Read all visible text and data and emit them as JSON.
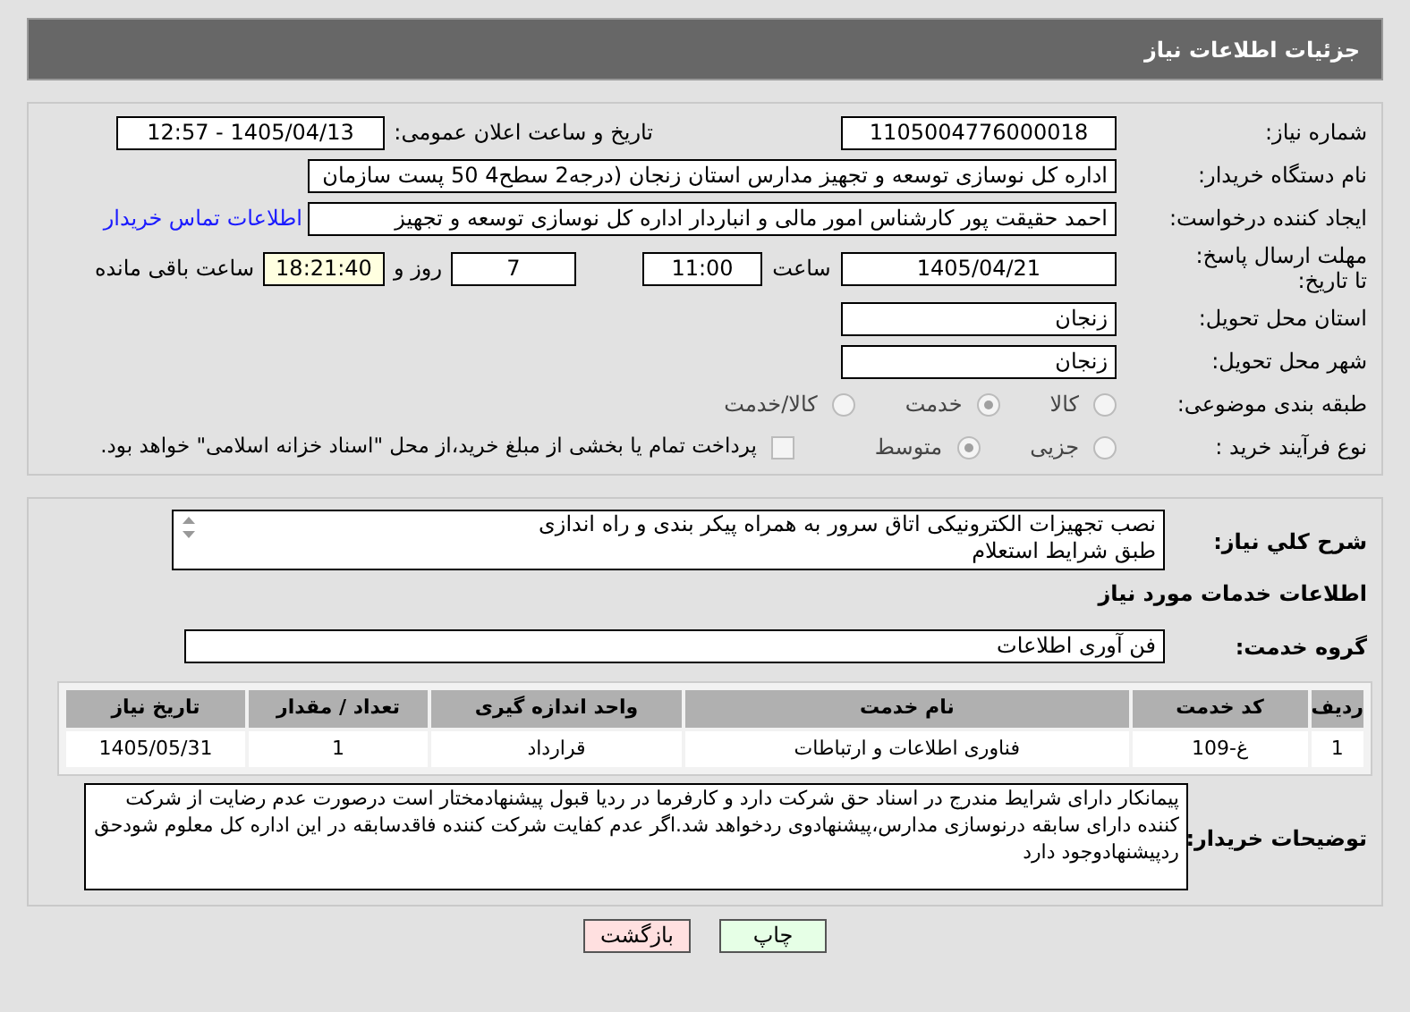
{
  "header": {
    "title": "جزئیات اطلاعات نیاز"
  },
  "need_number": {
    "label": "شماره نیاز:",
    "value": "1105004776000018"
  },
  "announce": {
    "label": "تاریخ و ساعت اعلان عمومی:",
    "value": "1405/04/13 - 12:57"
  },
  "buyer": {
    "label": "نام دستگاه خریدار:",
    "value": "اداره کل نوسازی   توسعه و تجهیز مدارس استان زنجان (درجه2  سطح4  50 پست سازمان"
  },
  "creator": {
    "label": "ایجاد کننده درخواست:",
    "value": "احمد حقیقت پور کارشناس امور مالی و انباردار اداره کل نوسازی   توسعه و تجهیز",
    "link": "اطلاعات تماس خریدار"
  },
  "deadline": {
    "label": "مهلت ارسال پاسخ: تا تاریخ:",
    "date": "1405/04/21",
    "time_label": "ساعت",
    "time": "11:00",
    "days": "7",
    "days_label": "روز و",
    "remaining": "18:21:40",
    "remaining_label": "ساعت باقی مانده"
  },
  "province": {
    "label": "استان محل تحویل:",
    "value": "زنجان"
  },
  "city": {
    "label": "شهر محل تحویل:",
    "value": "زنجان"
  },
  "category": {
    "label": "طبقه بندی موضوعی:",
    "options": [
      {
        "label": "کالا",
        "selected": false
      },
      {
        "label": "خدمت",
        "selected": true
      },
      {
        "label": "کالا/خدمت",
        "selected": false
      }
    ]
  },
  "process": {
    "label": "نوع فرآیند خرید :",
    "options": [
      {
        "label": "جزیی",
        "selected": false
      },
      {
        "label": "متوسط",
        "selected": true
      }
    ],
    "payment": {
      "checked": false,
      "label": "پرداخت تمام یا بخشی از مبلغ خرید،از محل \"اسناد خزانه اسلامی\" خواهد بود."
    }
  },
  "description": {
    "label": "شرح کلي نياز:",
    "lines": [
      "نصب تجهیزات الکترونیکی اتاق سرور به همراه پیکر بندی و راه اندازی",
      "طبق شرایط استعلام"
    ]
  },
  "services_title": "اطلاعات خدمات مورد نیاز",
  "service_group": {
    "label": "گروه خدمت:",
    "value": "فن آوری اطلاعات"
  },
  "table": {
    "columns": [
      "ردیف",
      "کد خدمت",
      "نام خدمت",
      "واحد اندازه گیری",
      "تعداد / مقدار",
      "تاریخ نیاز"
    ],
    "rows": [
      [
        "1",
        "غ-109",
        "فناوری اطلاعات و ارتباطات",
        "قرارداد",
        "1",
        "1405/05/31"
      ]
    ]
  },
  "buyer_notes": {
    "label": "توضیحات خریدار:",
    "value": "پیمانکار دارای شرایط مندرج در اسناد حق شرکت دارد و کارفرما در ردیا قبول پیشنهادمختار است درصورت عدم رضایت از شرکت کننده دارای سابقه درنوسازی مدارس،پیشنهادوی ردخواهد شد.اگر عدم کفایت شرکت کننده فاقدسابقه در این اداره کل معلوم شودحق ردپیشنهادوجود دارد"
  },
  "buttons": [
    {
      "label": "چاپ",
      "kind": "print"
    },
    {
      "label": "بازگشت",
      "kind": "back"
    }
  ]
}
